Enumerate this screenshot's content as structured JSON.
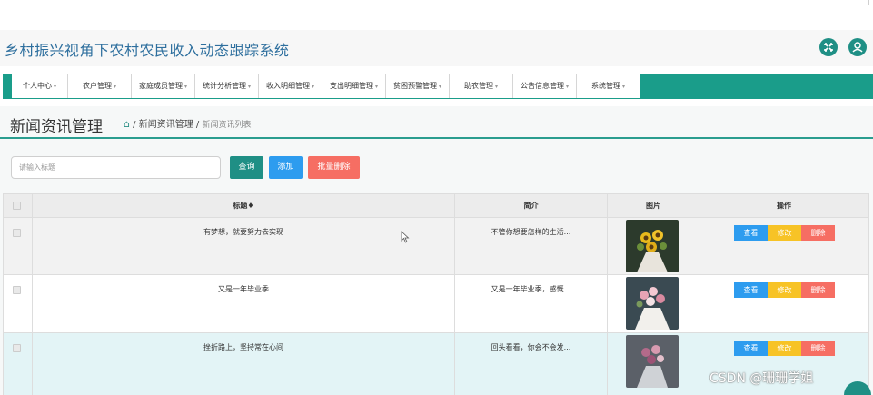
{
  "app": {
    "title": "乡村振兴视角下农村农民收入动态跟踪系统",
    "header_icons": [
      "fullscreen-icon",
      "user-icon"
    ]
  },
  "nav": {
    "caret": "▾",
    "items": [
      {
        "label": "个人中心"
      },
      {
        "label": "农户管理"
      },
      {
        "label": "家庭成员管理"
      },
      {
        "label": "统计分析管理"
      },
      {
        "label": "收入明细管理"
      },
      {
        "label": "支出明细管理"
      },
      {
        "label": "贫困预警管理"
      },
      {
        "label": "助农管理"
      },
      {
        "label": "公告信息管理"
      },
      {
        "label": "系统管理"
      }
    ]
  },
  "page": {
    "heading": "新闻资讯管理",
    "breadcrumb": {
      "sep": "/",
      "level1": "新闻资讯管理",
      "current": "新闻资讯列表"
    }
  },
  "search": {
    "placeholder": "请输入标题",
    "query_label": "查询",
    "add_label": "添加",
    "batch_delete_label": "批量删除"
  },
  "table": {
    "columns": {
      "title": "标题",
      "sort_glyph": "♦",
      "intro": "简介",
      "image": "图片",
      "actions": "操作"
    },
    "action_labels": {
      "view": "查看",
      "edit": "修改",
      "delete": "删除"
    },
    "rows": [
      {
        "title": "有梦想，就要努力去实现",
        "intro": "不管你想要怎样的生活..."
      },
      {
        "title": "又是一年毕业季",
        "intro": "又是一年毕业季，感慨..."
      },
      {
        "title": "挫折路上，坚持常在心间",
        "intro": "回头看看，你会不会发..."
      }
    ]
  },
  "colors": {
    "brand_teal": "#1a9d8a",
    "title_blue": "#2e6f9e",
    "query_btn": "#1f8f85",
    "add_btn": "#2d9cef",
    "delete_btn": "#f66e63",
    "edit_btn": "#f7c326",
    "selected_row": "#e3f4f6"
  },
  "watermark": "CSDN @珊珊学姐"
}
